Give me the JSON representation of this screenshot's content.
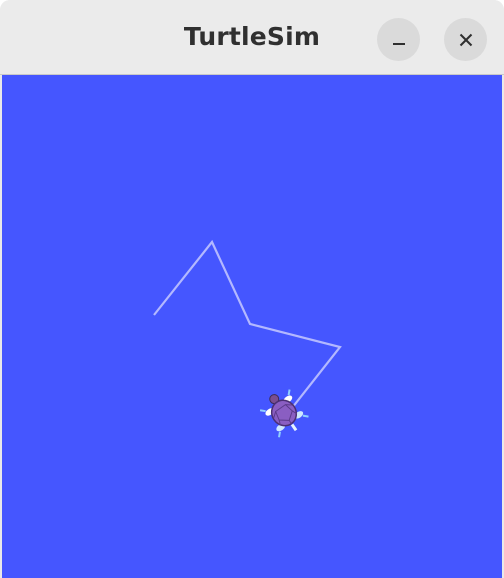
{
  "window": {
    "title": "TurtleSim",
    "background_color": "#4556ff",
    "pen_color": "#b3b8ff"
  },
  "titlebar": {
    "buttons": [
      {
        "name": "minimize",
        "icon": "minimize-icon"
      },
      {
        "name": "close",
        "icon": "close-icon"
      }
    ]
  },
  "turtle": {
    "icon": "turtle-icon"
  }
}
